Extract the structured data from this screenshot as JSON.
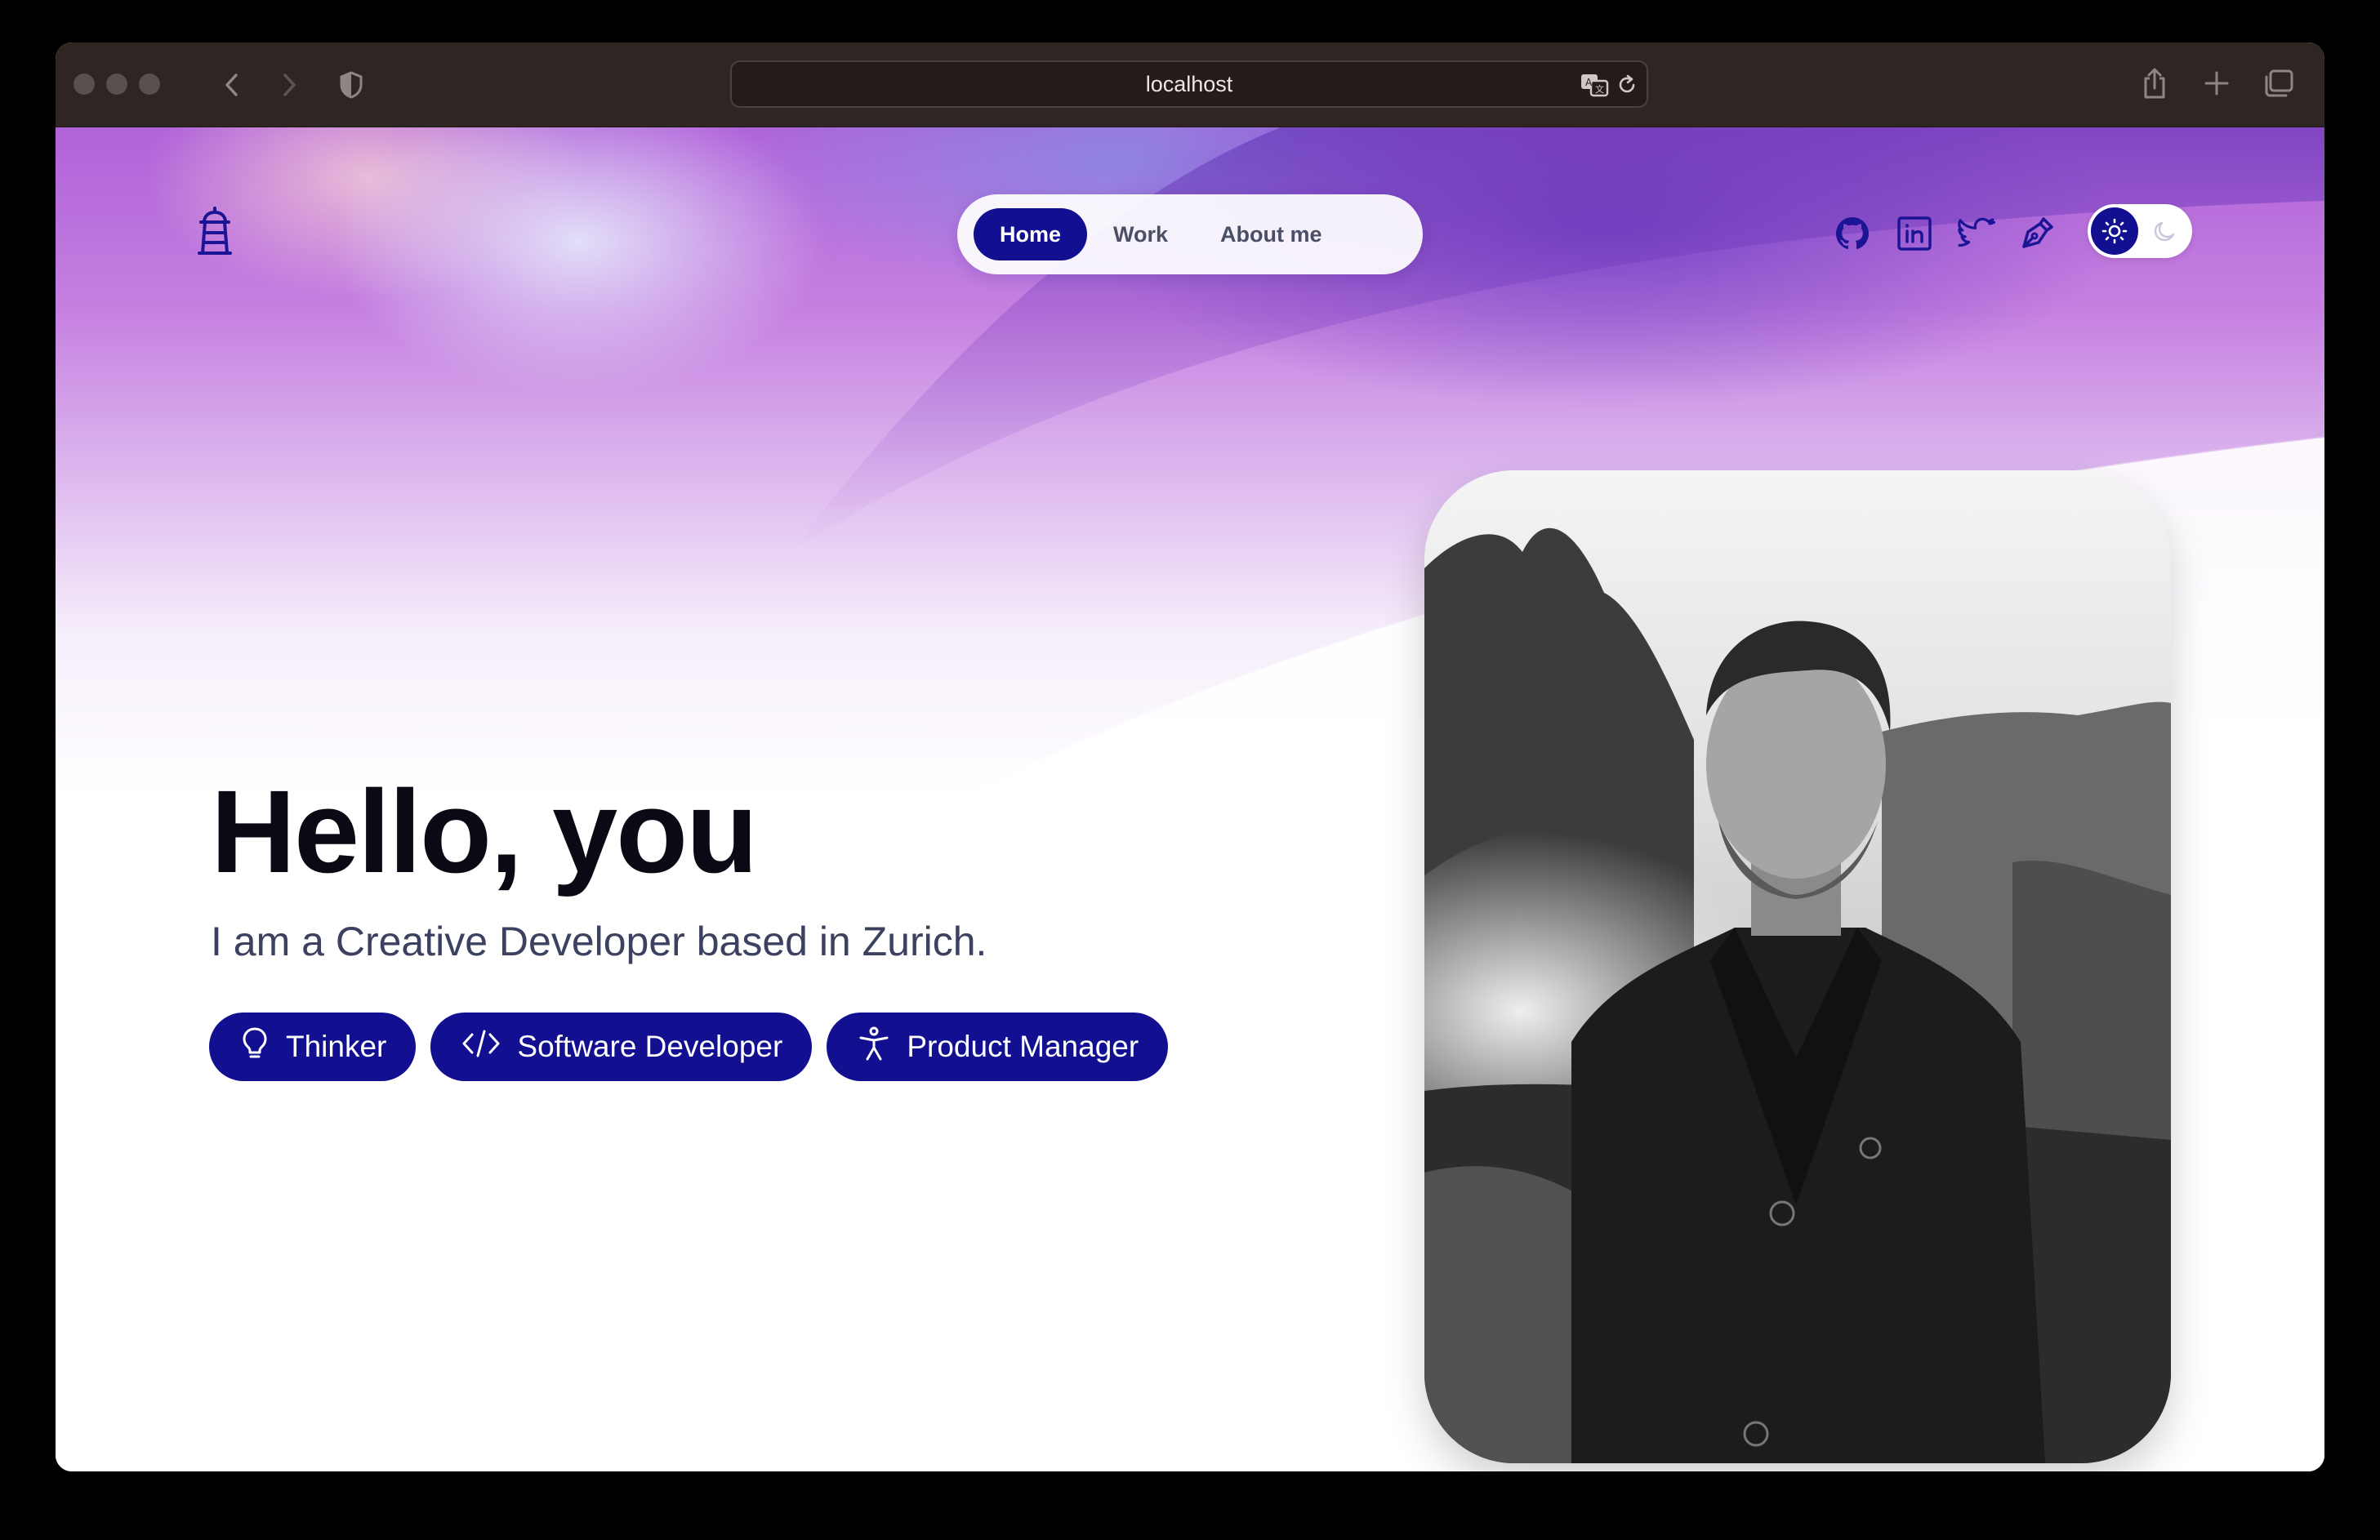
{
  "browser": {
    "url": "localhost",
    "icons": {
      "back": "chevron-left-icon",
      "forward": "chevron-right-icon",
      "privacy": "shield-icon",
      "translate": "translate-icon",
      "reload": "reload-icon",
      "share": "share-icon",
      "new_tab": "plus-icon",
      "tabs": "tabs-overview-icon"
    }
  },
  "header": {
    "logo": "lighthouse-icon",
    "nav": [
      {
        "label": "Home",
        "active": true
      },
      {
        "label": "Work",
        "active": false
      },
      {
        "label": "About me",
        "active": false
      }
    ],
    "social": [
      "github-icon",
      "linkedin-icon",
      "twitter-icon",
      "pen-tool-icon"
    ],
    "theme_toggle": {
      "selected": "light",
      "options": [
        "sun-icon",
        "moon-icon"
      ]
    }
  },
  "hero": {
    "title": "Hello, you",
    "subtitle": "I am a Creative Developer based in Zurich.",
    "chips": [
      {
        "label": "Thinker",
        "icon": "lightbulb-icon"
      },
      {
        "label": "Software Developer",
        "icon": "code-icon"
      },
      {
        "label": "Product Manager",
        "icon": "accessibility-icon"
      }
    ]
  },
  "colors": {
    "accent": "#120f91",
    "title": "#0b0a14",
    "subtitle": "#3c4160"
  }
}
